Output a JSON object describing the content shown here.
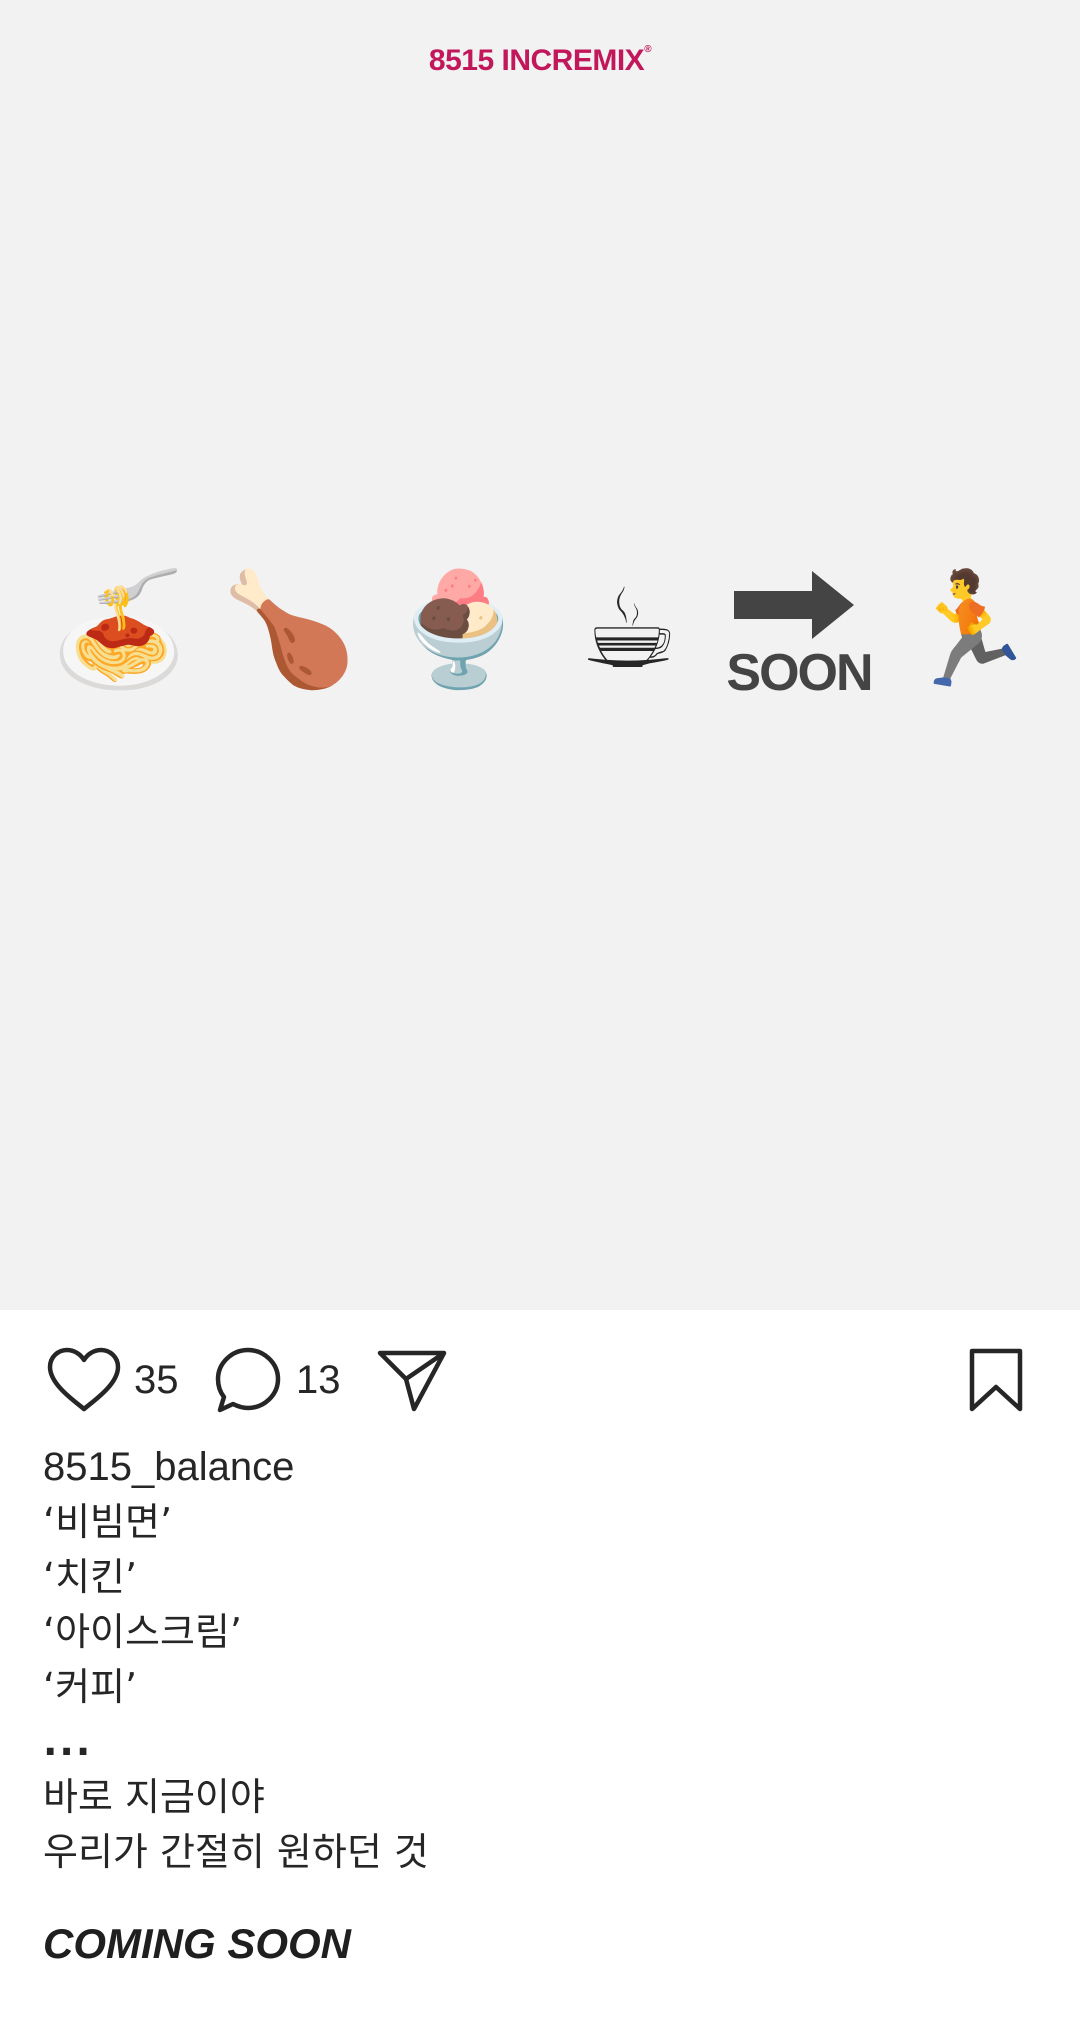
{
  "post": {
    "brand_number": "8515",
    "brand_name": "INCREMIX",
    "brand_mark": "®",
    "emojis": [
      {
        "name": "spaghetti-icon",
        "glyph": "🍝"
      },
      {
        "name": "poultry-leg-icon",
        "glyph": "🍗"
      },
      {
        "name": "ice-cream-icon",
        "glyph": "🍨"
      },
      {
        "name": "hot-coffee-icon",
        "glyph": "☕"
      },
      {
        "name": "soon-arrow-icon",
        "glyph": "🔜"
      },
      {
        "name": "person-running-icon",
        "glyph": "🏃"
      }
    ],
    "soon_text": "SOON",
    "image_background": "#f2f2f2",
    "brand_color": "#c2185b"
  },
  "actions": {
    "like_icon": "heart-icon",
    "like_count": "35",
    "comment_icon": "comment-icon",
    "comment_count": "13",
    "share_icon": "paper-plane-icon",
    "save_icon": "bookmark-icon"
  },
  "caption": {
    "username": "8515_balance",
    "lines": [
      "‘비빔면’",
      "‘치킨’",
      "‘아이스크림’",
      "‘커피’",
      "...",
      "바로 지금이야",
      "우리가 간절히 원하던 것"
    ],
    "headline": "COMING SOON"
  }
}
